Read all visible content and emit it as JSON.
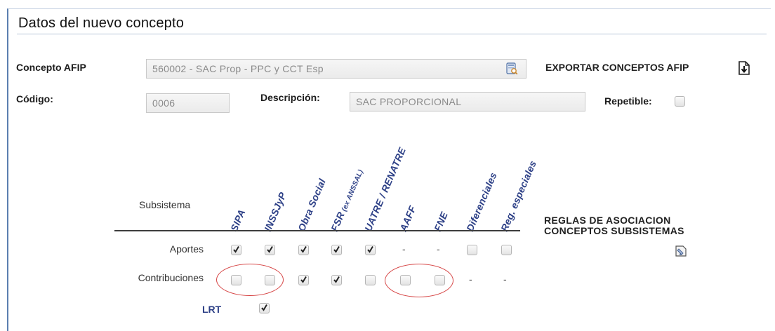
{
  "section": {
    "title": "Datos del nuevo concepto"
  },
  "concepto_afip": {
    "label": "Concepto AFIP",
    "value": "560002 - SAC  Prop - PPC y CCT Esp",
    "lookup_icon": "lookup-icon"
  },
  "export": {
    "label": "EXPORTAR CONCEPTOS AFIP",
    "icon": "download-icon"
  },
  "codigo": {
    "label": "Código:",
    "value": "0006"
  },
  "descripcion": {
    "label": "Descripción:",
    "value": "SAC PROPORCIONAL"
  },
  "repetible": {
    "label": "Repetible:",
    "checked": false
  },
  "subsistemas": {
    "header_label": "Subsistema",
    "columns": [
      {
        "key": "sipa",
        "label": "SIPA"
      },
      {
        "key": "inssjyp",
        "label": "INSSJyP"
      },
      {
        "key": "obra_social",
        "label": "Obra Social"
      },
      {
        "key": "fsr",
        "label": "FSR",
        "sub": "(ex ANSSAL)"
      },
      {
        "key": "uatre",
        "label": "UATRE / RENATRE"
      },
      {
        "key": "aaff",
        "label": "AAFF"
      },
      {
        "key": "fne",
        "label": "FNE"
      },
      {
        "key": "diferenciales",
        "label": "Diferenciales"
      },
      {
        "key": "reg_especiales",
        "label": "Reg. especiales"
      }
    ],
    "rows": [
      {
        "label": "Aportes",
        "cells": [
          "checked",
          "checked",
          "checked",
          "checked",
          "checked",
          "-",
          "-",
          "unchecked",
          "unchecked"
        ]
      },
      {
        "label": "Contribuciones",
        "cells": [
          "unchecked",
          "unchecked",
          "checked",
          "checked",
          "unchecked",
          "unchecked",
          "unchecked",
          "-",
          "-"
        ]
      }
    ],
    "lrt": {
      "label": "LRT",
      "checked": true
    }
  },
  "rules": {
    "label": "REGLAS DE ASOCIACION CONCEPTOS SUBSISTEMAS",
    "icon": "rules-edit-icon"
  },
  "colors": {
    "accent": "#2c3f86",
    "highlight": "#d64545",
    "frame": "#5b7fb0"
  }
}
